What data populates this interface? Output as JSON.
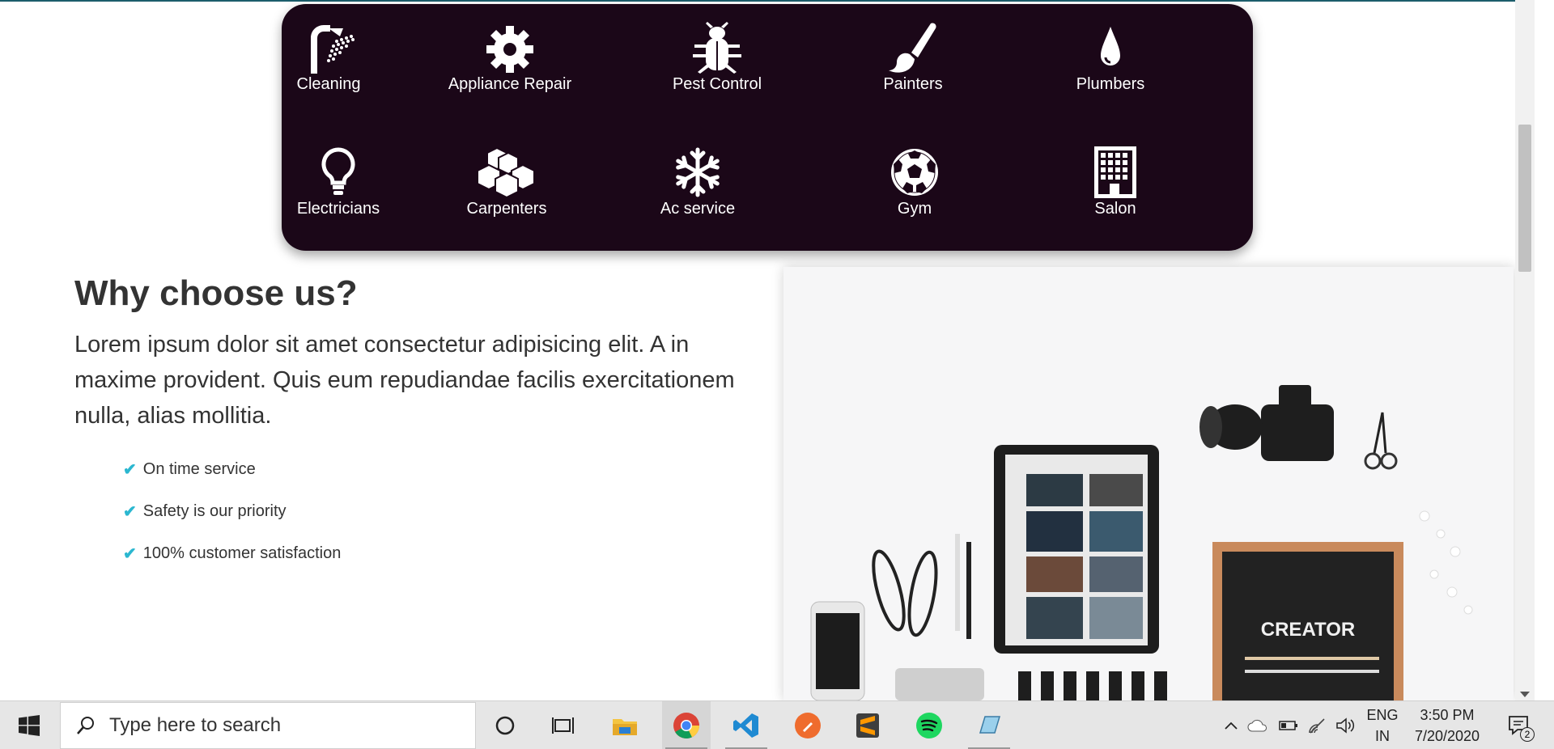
{
  "services": [
    {
      "label": "Cleaning",
      "icon": "shower-icon"
    },
    {
      "label": "Appliance Repair",
      "icon": "gear-icon"
    },
    {
      "label": "Pest Control",
      "icon": "bug-icon"
    },
    {
      "label": "Painters",
      "icon": "paintbrush-icon"
    },
    {
      "label": "Plumbers",
      "icon": "water-drop-icon"
    },
    {
      "label": "Electricians",
      "icon": "lightbulb-icon"
    },
    {
      "label": "Carpenters",
      "icon": "cubes-icon"
    },
    {
      "label": "Ac service",
      "icon": "snowflake-icon"
    },
    {
      "label": "Gym",
      "icon": "soccer-ball-icon"
    },
    {
      "label": "Salon",
      "icon": "building-icon"
    }
  ],
  "why": {
    "title": "Why choose us?",
    "description": "Lorem ipsum dolor sit amet consectetur adipisicing elit. A in maxime provident. Quis eum repudiandae facilis exercitationem nulla, alias mollitia.",
    "features": [
      "On time service",
      "Safety is our priority",
      "100% customer satisfaction"
    ]
  },
  "photo": {
    "board_text": "CREATOR"
  },
  "taskbar": {
    "search_placeholder": "Type here to search",
    "language_top": "ENG",
    "language_bottom": "IN",
    "time": "3:50 PM",
    "date": "7/20/2020",
    "notification_count": "2"
  },
  "colors": {
    "panel": "#1b0718",
    "accent": "#2bb7d0",
    "text": "#333333"
  }
}
